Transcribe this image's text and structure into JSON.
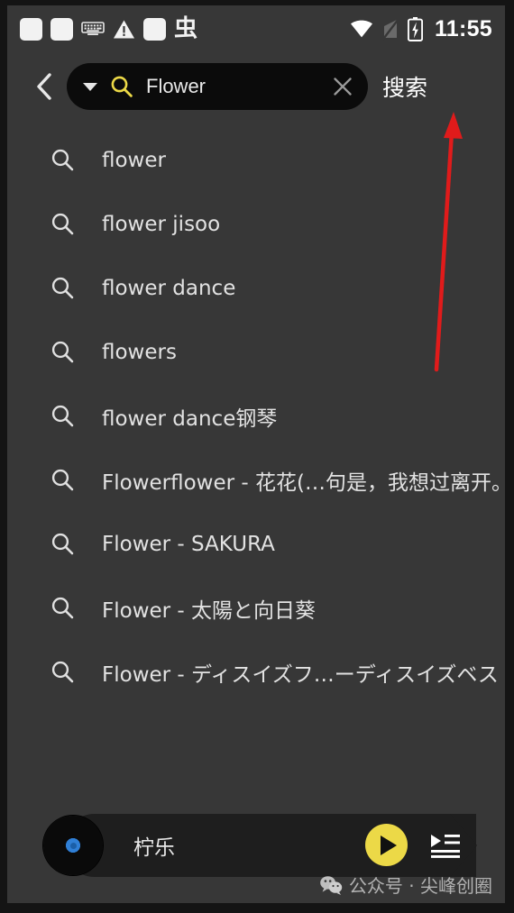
{
  "status_bar": {
    "left_icons": [
      {
        "name": "unknown-glyph-square-1",
        "glyph": "square"
      },
      {
        "name": "unknown-glyph-square-2",
        "glyph": "square"
      },
      {
        "name": "keyboard-icon",
        "glyph": "keyboard"
      },
      {
        "name": "warning-triangle-icon",
        "glyph": "warning"
      },
      {
        "name": "unknown-glyph-square-3",
        "glyph": "square"
      },
      {
        "name": "chinese-char-icon",
        "glyph": "虫"
      }
    ],
    "wifi_icon": "wifi-icon",
    "no_signal_icon": "no-signal-icon",
    "battery_icon": "battery-charging-icon",
    "time": "11:55"
  },
  "search_header": {
    "back_icon": "chevron-left-icon",
    "dropdown_icon": "chevron-down-icon",
    "search_icon": "search-icon",
    "query_value": "Flower",
    "placeholder": "Flower",
    "clear_icon": "close-icon",
    "action_label": "搜索"
  },
  "suggestions": {
    "row_icon": "search-icon",
    "items": [
      {
        "text": "flower"
      },
      {
        "text": "flower jisoo"
      },
      {
        "text": "flower dance"
      },
      {
        "text": "flowers"
      },
      {
        "text": "flower dance钢琴"
      },
      {
        "text": "Flowerflower - 花花(…句是，我想过离开。"
      },
      {
        "text": "Flower - SAKURA"
      },
      {
        "text": "Flower - 太陽と向日葵"
      },
      {
        "text": "Flower - ディスイズフ…ーディスイズベスト"
      }
    ]
  },
  "player": {
    "album_art": "vinyl-record-icon",
    "track_title": "柠乐",
    "play_icon": "play-icon",
    "queue_icon": "play-queue-icon"
  },
  "watermark": {
    "icon": "wechat-icon",
    "text": "公众号 · 尖峰创圈"
  },
  "annotation": {
    "arrow_color": "#e01b1b",
    "points_to": "搜索"
  },
  "colors": {
    "screen_background": "#373737",
    "frame": "#141414",
    "search_pill": "#0b0b0b",
    "accent_yellow": "#ecd947",
    "text_primary": "#e6e6e6",
    "player_background": "#1e1e1e",
    "vinyl_label_blue": "#2f7fd6"
  }
}
